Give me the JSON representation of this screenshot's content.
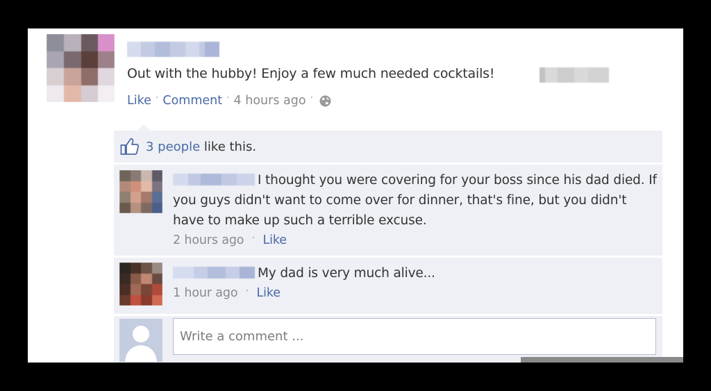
{
  "post": {
    "text": "Out with the hubby! Enjoy a few much needed cocktails!",
    "like_label": "Like",
    "comment_label": "Comment",
    "timestamp": "4 hours ago",
    "separator": "·",
    "audience_icon": "globe-icon"
  },
  "likes": {
    "icon": "thumbs-up-icon",
    "count_label": "3 people",
    "suffix": "like this."
  },
  "comments": [
    {
      "text": "I thought you were covering for your boss since his dad died. If you guys didn't want to come over for dinner, that's fine, but you didn't have to make up such a terrible excuse.",
      "timestamp": "2 hours ago",
      "like_label": "Like"
    },
    {
      "text": "My dad is very much alive...",
      "timestamp": "1 hour ago",
      "like_label": "Like"
    }
  ],
  "composer": {
    "placeholder": "Write a comment ..."
  },
  "colors": {
    "link": "#4a6aa6",
    "panel": "#eef0f5",
    "meta": "#8a8a8a"
  }
}
